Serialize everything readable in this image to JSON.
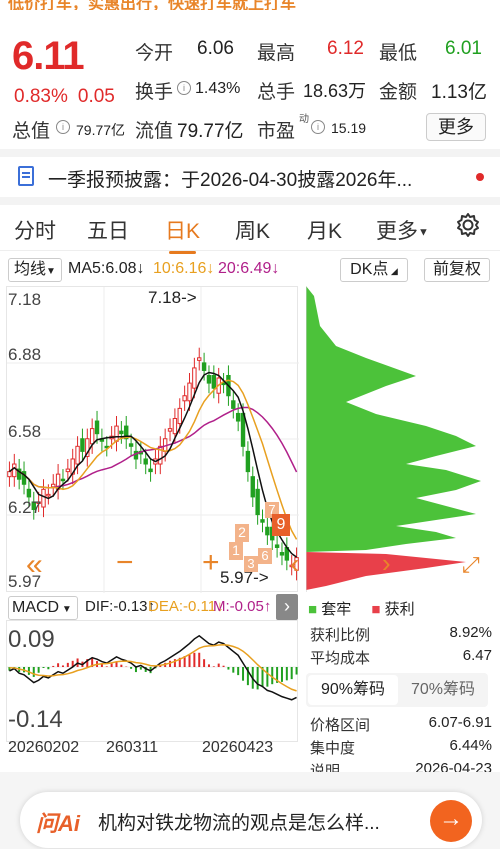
{
  "header_strip": "低价打车，实惠出行，快速打车就上打车",
  "quote": {
    "price": "6.11",
    "change_pct": "0.83%",
    "change_abs": "0.05",
    "rows": [
      {
        "l1": "今开",
        "v1": "6.06",
        "l2": "最高",
        "v2": "6.12",
        "l3": "最低",
        "v3": "6.01"
      },
      {
        "l1": "换手",
        "v1": "1.43%",
        "l2": "总手",
        "v2": "18.63万",
        "l3": "金额",
        "v3": "1.13亿"
      },
      {
        "l1": "总值",
        "v1": "79.77亿",
        "l2": "流值",
        "v2": "79.77亿",
        "l3": "市盈",
        "v3": "15.19",
        "l3sup": "动"
      }
    ],
    "more_label": "更多"
  },
  "notice": {
    "text": "一季报预披露：于2026-04-30披露2026年..."
  },
  "tabs": [
    "分时",
    "五日",
    "日K",
    "周K",
    "月K",
    "更多"
  ],
  "active_tab": "日K",
  "chart_header": {
    "indicator_label": "均线",
    "ma5": "MA5:6.08↓",
    "ma10": "10:6.16↓",
    "ma20": "20:6.49↓",
    "dk_label": "DK点",
    "adjust_label": "前复权"
  },
  "kline": {
    "y_labels": [
      "7.18",
      "6.88",
      "6.58",
      "6.27",
      "5.97"
    ],
    "max_annot": "7.18->",
    "min_annot": "5.97->",
    "badges": [
      "7",
      "9",
      "2",
      "1",
      "3",
      "6"
    ]
  },
  "macd_header": {
    "label": "MACD",
    "dif": "DIF:-0.13↑",
    "dea": "DEA:-0.11↓",
    "m": "M:-0.05↑"
  },
  "macd": {
    "y_labels": [
      "0.09",
      "-0.14"
    ]
  },
  "dates": [
    "20260202",
    "260311",
    "20260423"
  ],
  "chips": {
    "legend_trapped": "套牢",
    "legend_profit": "获利",
    "rows_top": [
      {
        "label": "获利比例",
        "value": "8.92%"
      },
      {
        "label": "平均成本",
        "value": "6.47"
      }
    ],
    "tab_on": "90%筹码",
    "tab_off": "70%筹码",
    "rows_bottom": [
      {
        "label": "价格区间",
        "value": "6.07-6.91"
      },
      {
        "label": "集中度",
        "value": "6.44%"
      },
      {
        "label": "说明",
        "value": "2026-04-23"
      }
    ]
  },
  "ask": {
    "logo": "问Ai",
    "question": "机构对铁龙物流的观点是怎么样..."
  },
  "colors": {
    "up": "#e02a2a",
    "down": "#20a020",
    "accent": "#e67a1f",
    "ma5": "#111111",
    "ma10": "#e8a020",
    "ma20": "#b0208a"
  }
}
